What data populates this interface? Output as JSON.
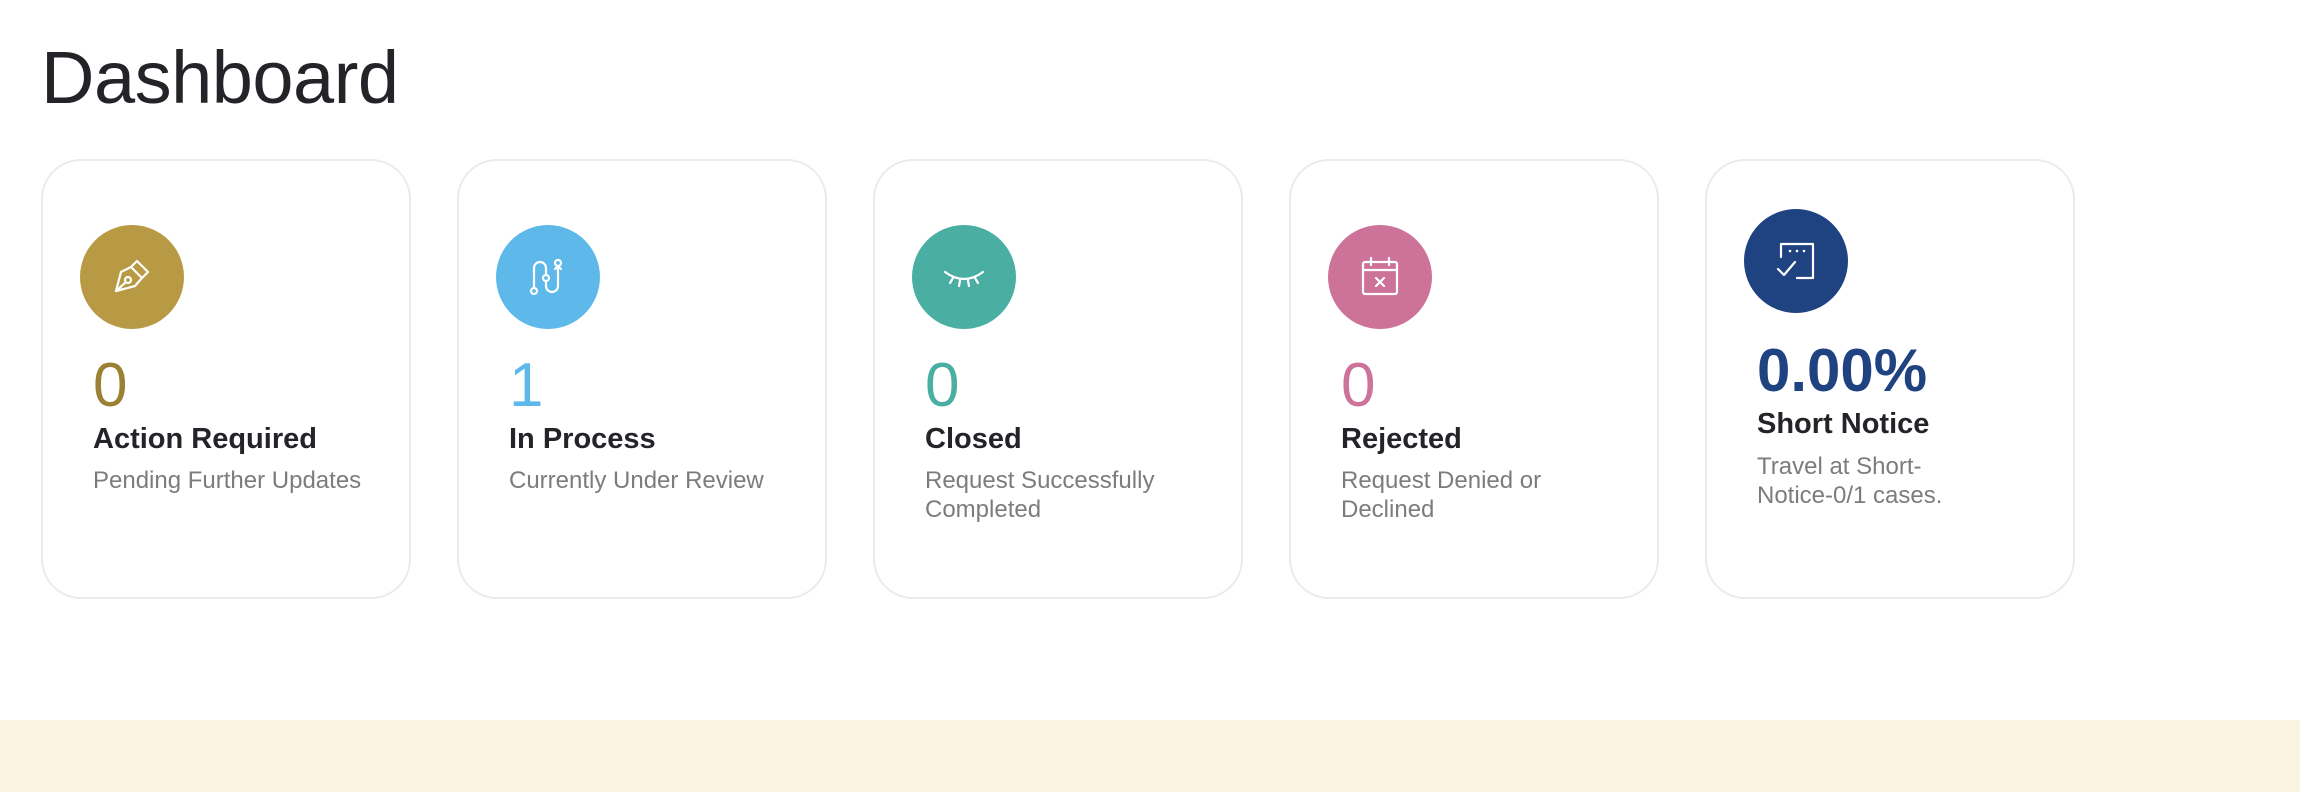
{
  "page": {
    "title": "Dashboard"
  },
  "colors": {
    "action_required": "#b89a45",
    "in_process": "#5eb9ea",
    "closed": "#4aaea2",
    "rejected": "#cd7399",
    "short_notice": "#1f4280",
    "footer_band": "#faf3e2"
  },
  "cards": [
    {
      "key": "action_required",
      "icon": "pen-nib-icon",
      "count": "0",
      "label": "Action Required",
      "description": "Pending Further Updates"
    },
    {
      "key": "in_process",
      "icon": "route-icon",
      "count": "1",
      "label": "In Process",
      "description": "Currently Under Review"
    },
    {
      "key": "closed",
      "icon": "closed-eye-icon",
      "count": "0",
      "label": "Closed",
      "description": "Request Successfully Completed"
    },
    {
      "key": "rejected",
      "icon": "calendar-x-icon",
      "count": "0",
      "label": "Rejected",
      "description": "Request Denied or Declined"
    },
    {
      "key": "short_notice",
      "icon": "note-check-icon",
      "count": "0.00%",
      "label": "Short Notice",
      "description": "Travel at Short-Notice-0/1 cases."
    }
  ]
}
